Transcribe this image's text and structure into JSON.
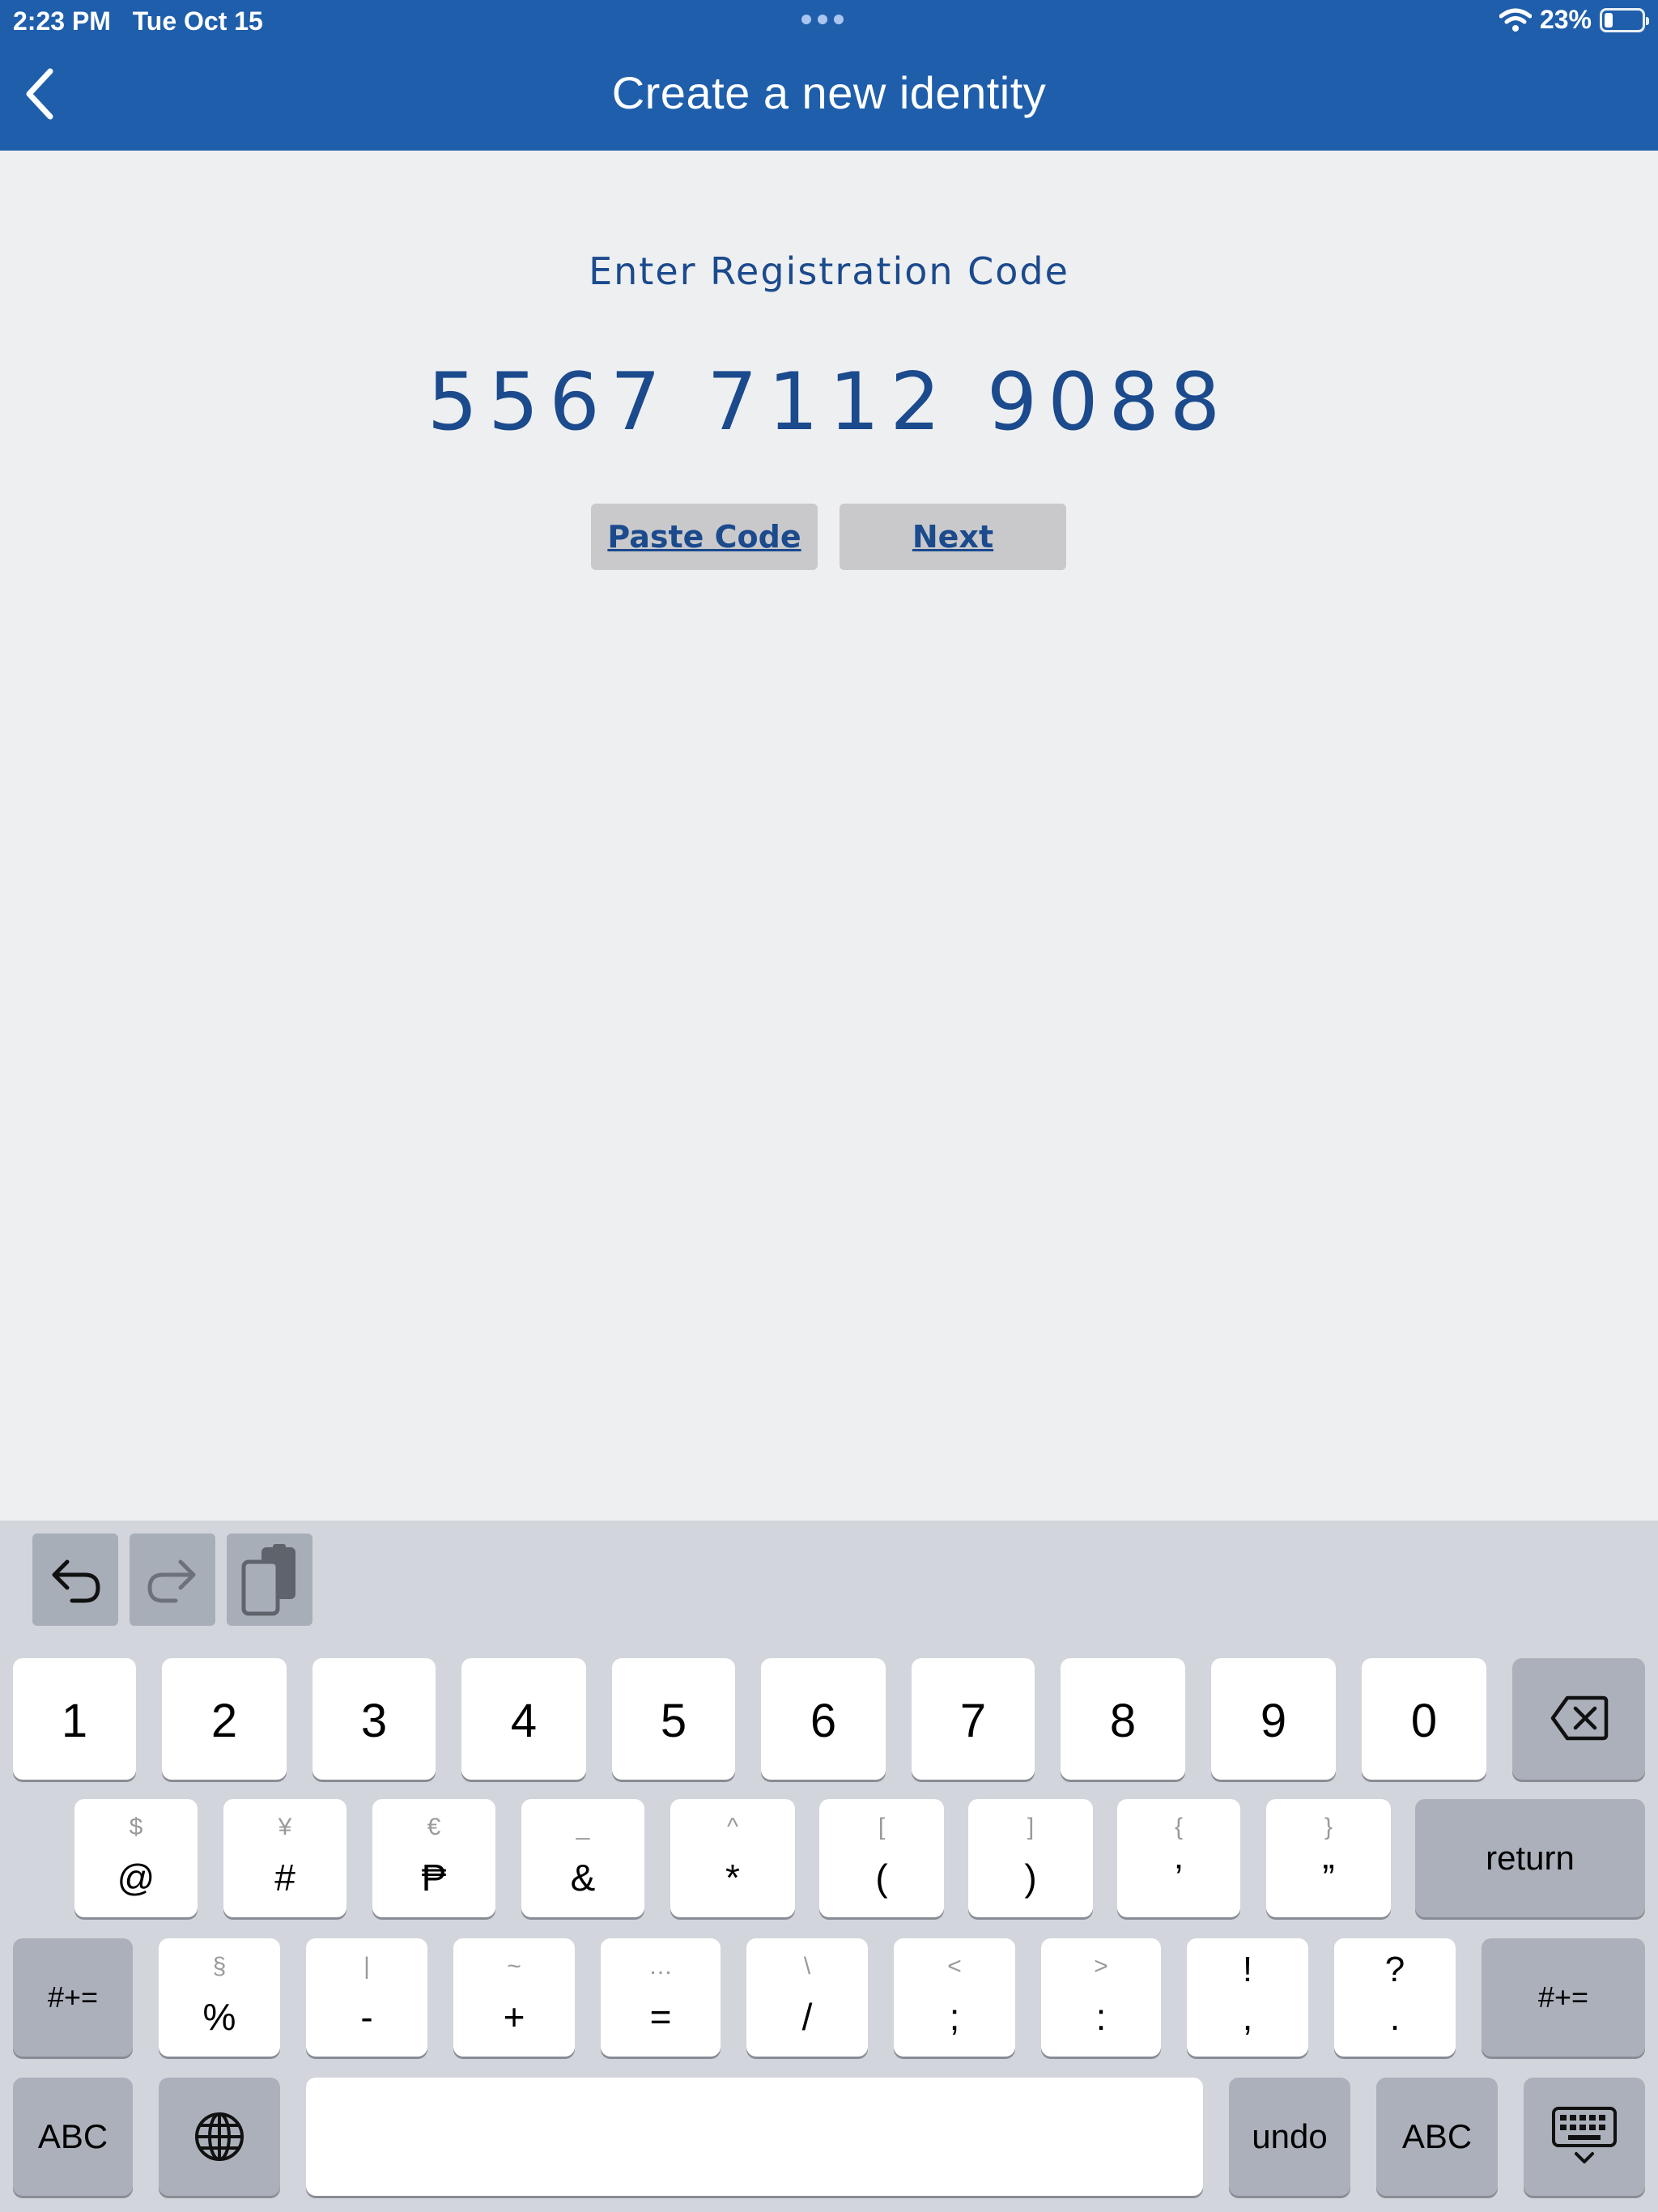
{
  "status_bar": {
    "time": "2:23 PM",
    "date": "Tue Oct 15",
    "battery": "23%",
    "battery_level": 0.23
  },
  "nav": {
    "back_icon": "chevron-left-icon",
    "title": "Create a new identity"
  },
  "content": {
    "label": "Enter Registration Code",
    "code": "5567 7112 9088",
    "paste_button": "Paste Code",
    "next_button": "Next"
  },
  "keyboard": {
    "toolbar": [
      "undo-icon",
      "redo-icon",
      "paste-icon"
    ],
    "number_row": [
      "1",
      "2",
      "3",
      "4",
      "5",
      "6",
      "7",
      "8",
      "9",
      "0"
    ],
    "row2": [
      {
        "main": "@",
        "sub": "$"
      },
      {
        "main": "#",
        "sub": "¥"
      },
      {
        "main": "₱",
        "sub": "€"
      },
      {
        "main": "&",
        "sub": "_"
      },
      {
        "main": "*",
        "sub": "^"
      },
      {
        "main": "(",
        "sub": "["
      },
      {
        "main": ")",
        "sub": "]"
      },
      {
        "main": "’",
        "sub": "{"
      },
      {
        "main": "”",
        "sub": "}"
      }
    ],
    "return_label": "return",
    "row3": [
      {
        "main": "%",
        "sub": "§"
      },
      {
        "main": "-",
        "sub": "|"
      },
      {
        "main": "+",
        "sub": "~"
      },
      {
        "main": "=",
        "sub": "…"
      },
      {
        "main": "/",
        "sub": "\\"
      },
      {
        "main": ";",
        "sub": "<"
      },
      {
        "main": ":",
        "sub": ">"
      },
      {
        "main": ",",
        "sub": "!"
      },
      {
        "main": ".",
        "sub": "?"
      }
    ],
    "symbols_label": "#+=",
    "abc_label": "ABC",
    "undo_label": "undo"
  },
  "colors": {
    "header": "#1f5eab",
    "text_accent": "#1b4a8d",
    "background": "#eeeff1"
  }
}
